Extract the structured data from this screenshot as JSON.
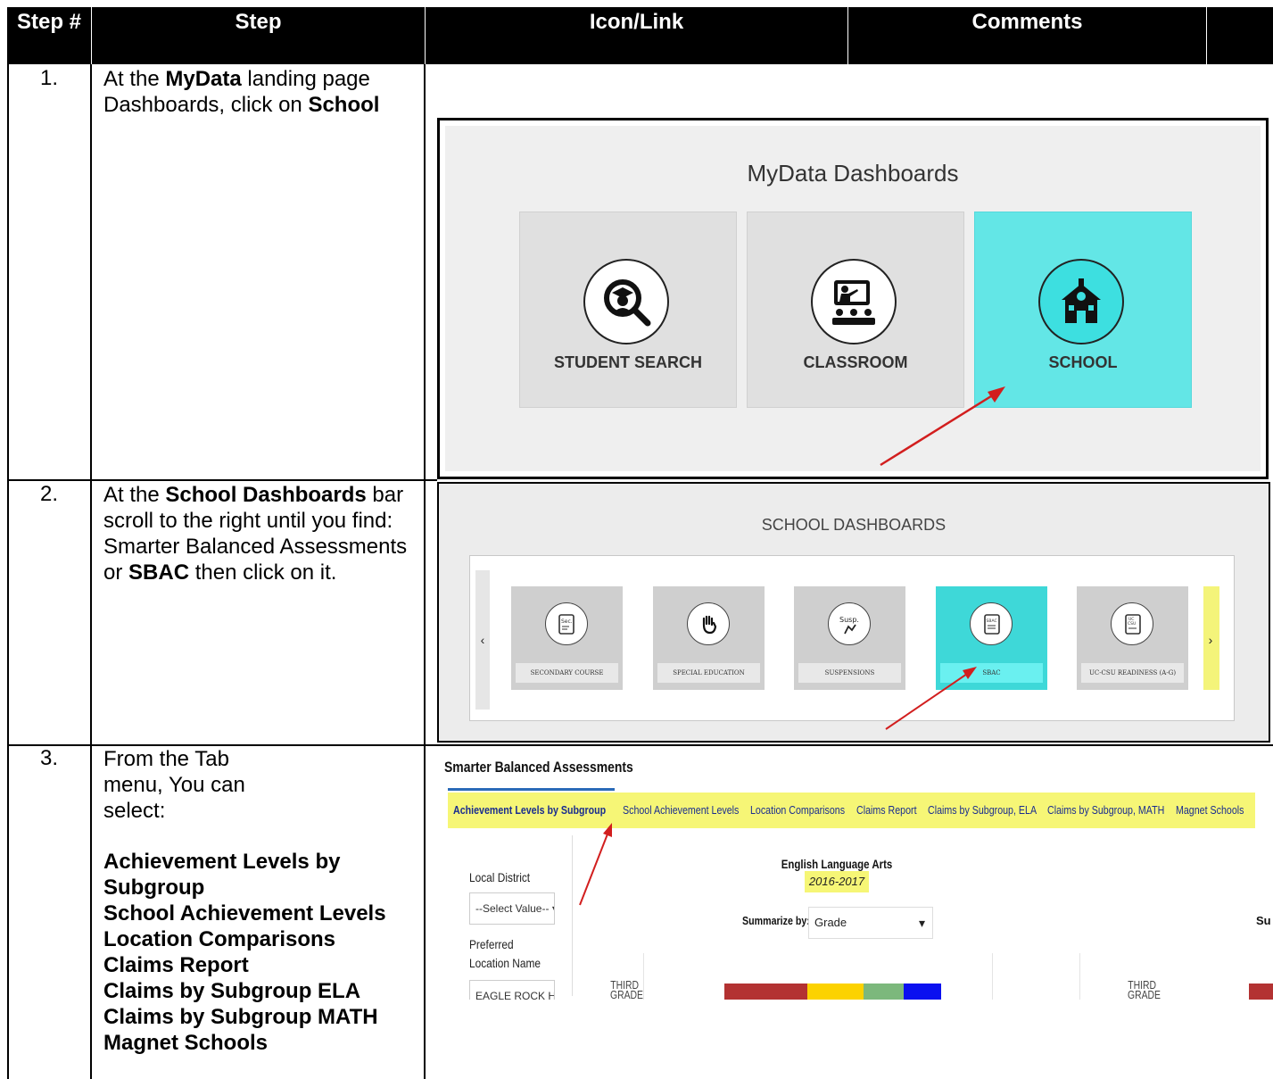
{
  "header": {
    "col1": "Step #",
    "col2": "Step",
    "col3": "Icon/Link",
    "col4": "Comments"
  },
  "rows": [
    {
      "num": "1.",
      "text": [
        "At the ",
        "MyData",
        " landing page Dashboards, click on ",
        "School"
      ]
    },
    {
      "num": "2.",
      "text": [
        "At the ",
        "School Dashboards",
        " bar scroll to the right until you find: Smarter Balanced Assessments or ",
        "SBAC",
        " then click on it."
      ]
    },
    {
      "num": "3.",
      "intro": "From the Tab menu, You can select:",
      "options": [
        "Achievement Levels by Subgroup",
        "School Achievement Levels",
        "Location Comparisons",
        "Claims Report",
        "Claims by Subgroup ELA",
        "Claims by Subgroup MATH",
        "Magnet Schools"
      ]
    }
  ],
  "shot1": {
    "title": "MyData Dashboards",
    "tiles": [
      {
        "label": "STUDENT SEARCH",
        "icon": "student-search-icon"
      },
      {
        "label": "CLASSROOM",
        "icon": "classroom-icon"
      },
      {
        "label": "SCHOOL",
        "icon": "school-icon"
      }
    ],
    "active_color": "#63e6e6"
  },
  "shot2": {
    "title": "SCHOOL DASHBOARDS",
    "tiles": [
      {
        "label": "SECONDARY COURSE",
        "icon_text": "Sec."
      },
      {
        "label": "SPECIAL EDUCATION",
        "icon_text": ""
      },
      {
        "label": "SUSPENSIONS",
        "icon_text": "Susp."
      },
      {
        "label": "SBAC",
        "icon_text": "SBAC"
      },
      {
        "label": "UC-CSU READINESS (A-G)",
        "icon_text": "UC CSU"
      }
    ],
    "nav_left": "‹",
    "nav_right": "›"
  },
  "shot3": {
    "title": "Smarter Balanced Assessments",
    "tabs": [
      "Achievement Levels by Subgroup",
      "School Achievement Levels",
      "Location Comparisons",
      "Claims Report",
      "Claims by Subgroup, ELA",
      "Claims by Subgroup, MATH",
      "Magnet Schools"
    ],
    "local_district_label": "Local District",
    "local_district_value": "--Select Value--",
    "preferred_location_label_1": "Preferred",
    "preferred_location_label_2": "Location Name",
    "preferred_location_value": "EAGLE ROCK H",
    "subject": "English Language Arts",
    "year": "2016-2017",
    "summarize_label": "Summarize by:",
    "summarize_value": "Grade",
    "right_partial": "Su",
    "grade_line1": "THIRD",
    "grade_line2": "GRADE",
    "bar_colors": [
      "#b33232",
      "#fcd200",
      "#7cb87c",
      "#0a10f0"
    ],
    "bar_values": [
      31,
      21,
      15,
      14
    ]
  }
}
